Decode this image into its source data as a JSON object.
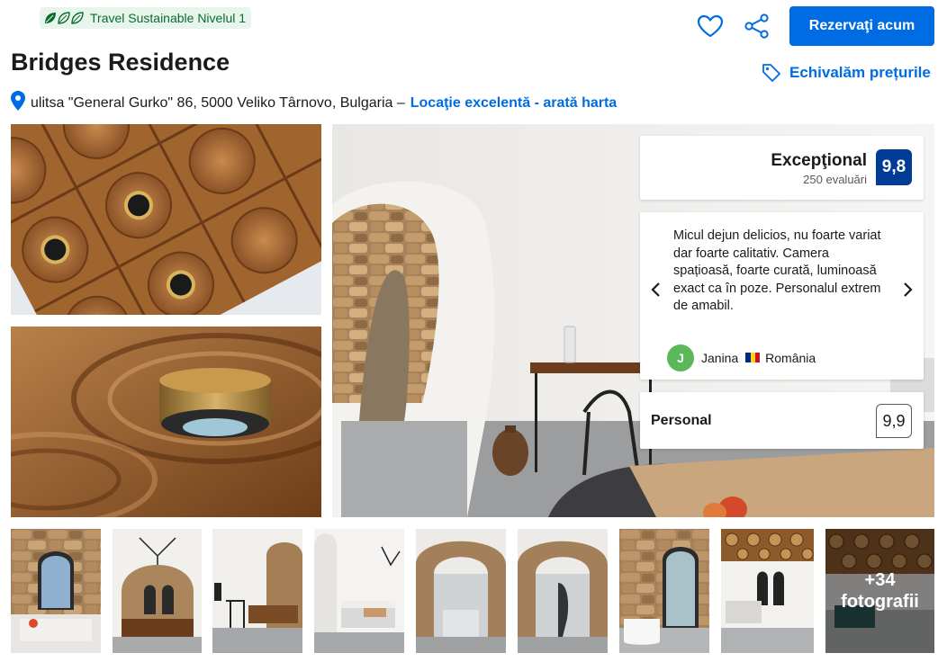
{
  "badge": {
    "label": "Travel Sustainable Nivelul 1"
  },
  "hotel": {
    "name": "Bridges Residence",
    "address": "ulitsa \"General Gurko\" 86, 5000 Veliko Târnovo, Bulgaria –",
    "location_link": "Locaţie excelentă - arată harta"
  },
  "actions": {
    "reserve_label": "Rezervaţi acum",
    "price_match_label": "Echivalăm prețurile"
  },
  "rating": {
    "label": "Excepţional",
    "reviews": "250 evaluări",
    "score": "9,8"
  },
  "review": {
    "text": "Micul dejun delicios, nu foarte variat dar foarte calitativ. Camera spațioasă, foarte curată, luminoasă exact ca în poze. Personalul extrem de amabil.",
    "author_initial": "J",
    "author_name": "Janina",
    "author_country": "România"
  },
  "staff": {
    "label": "Personal",
    "score": "9,9"
  },
  "gallery": {
    "more_count": "+34",
    "more_label": "fotografii"
  },
  "colors": {
    "primary": "#006ce4",
    "score_bg": "#003b95",
    "badge_green": "#0a6b2e",
    "avatar_green": "#5bb858"
  },
  "icons": [
    "leaf-icon",
    "heart-icon",
    "share-icon",
    "price-tag-icon",
    "location-pin-icon",
    "chevron-left-icon",
    "chevron-right-icon"
  ]
}
